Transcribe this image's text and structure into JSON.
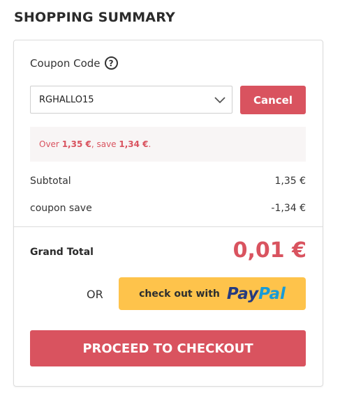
{
  "summary": {
    "title": "SHOPPING SUMMARY"
  },
  "coupon": {
    "label": "Coupon Code",
    "help_icon": "?",
    "selected": "RGHALLO15",
    "cancel_label": "Cancel"
  },
  "savings_message": {
    "prefix": "Over ",
    "over_amount": "1,35 €",
    "middle": ", save ",
    "save_amount": "1,34 €",
    "suffix": "."
  },
  "totals": {
    "subtotal_label": "Subtotal",
    "subtotal_value": "1,35 €",
    "coupon_label": "coupon save",
    "coupon_value": "-1,34 €",
    "grand_label": "Grand Total",
    "grand_value": "0,01 €"
  },
  "paypal": {
    "or_label": "OR",
    "prefix": "check out with",
    "logo_part1": "Pay",
    "logo_part2": "Pal"
  },
  "checkout": {
    "label": "PROCEED TO CHECKOUT"
  },
  "colors": {
    "accent": "#d9535f",
    "paypal_bg": "#fec34b",
    "paypal_dark": "#253b80",
    "paypal_light": "#179bd7"
  }
}
